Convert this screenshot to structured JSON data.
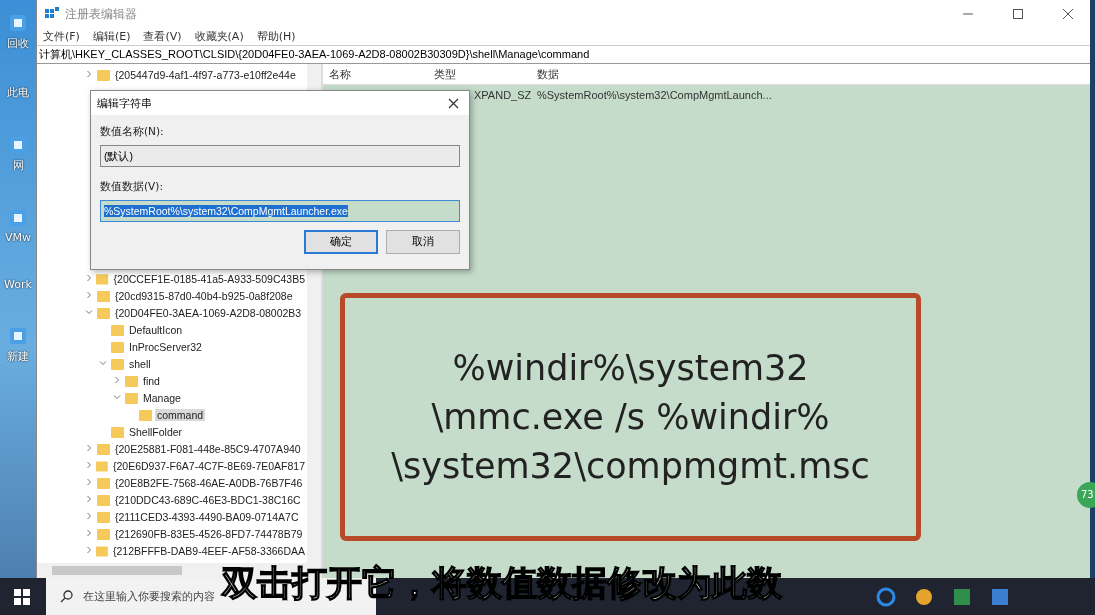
{
  "desktop_icons": [
    {
      "label": "回收"
    },
    {
      "label": "此电"
    },
    {
      "label": "网"
    },
    {
      "label": "VMw"
    },
    {
      "label": "Work"
    },
    {
      "label": "新建"
    }
  ],
  "window": {
    "title": "注册表编辑器",
    "menu": [
      "文件(F)",
      "编辑(E)",
      "查看(V)",
      "收藏夹(A)",
      "帮助(H)"
    ],
    "address": "计算机\\HKEY_CLASSES_ROOT\\CLSID\\{20D04FE0-3AEA-1069-A2D8-08002B30309D}\\shell\\Manage\\command"
  },
  "tree": [
    {
      "label": "{205447d9-4af1-4f97-a773-e10ff2e44e",
      "expandable": true,
      "expanded": false,
      "selected": false
    },
    {
      "label": "{20CCEF1E-0185-41a5-A933-509C43B5",
      "expandable": true,
      "expanded": false,
      "selected": false
    },
    {
      "label": "{20cd9315-87d0-40b4-b925-0a8f208e",
      "expandable": true,
      "expanded": false,
      "selected": false
    },
    {
      "label": "{20D04FE0-3AEA-1069-A2D8-08002B3",
      "expandable": true,
      "expanded": true,
      "selected": false,
      "children": [
        {
          "label": "DefaultIcon",
          "selected": false
        },
        {
          "label": "InProcServer32",
          "selected": false
        },
        {
          "label": "shell",
          "expandable": true,
          "expanded": true,
          "selected": false,
          "children": [
            {
              "label": "find",
              "expandable": true,
              "expanded": false,
              "selected": false
            },
            {
              "label": "Manage",
              "expandable": true,
              "expanded": true,
              "selected": false,
              "children": [
                {
                  "label": "command",
                  "selected": true
                }
              ]
            }
          ]
        },
        {
          "label": "ShellFolder",
          "selected": false
        }
      ]
    },
    {
      "label": "{20E25881-F081-448e-85C9-4707A940",
      "expandable": true,
      "expanded": false,
      "selected": false
    },
    {
      "label": "{20E6D937-F6A7-4C7F-8E69-7E0AF817",
      "expandable": true,
      "expanded": false,
      "selected": false
    },
    {
      "label": "{20E8B2FE-7568-46AE-A0DB-76B7F46",
      "expandable": true,
      "expanded": false,
      "selected": false
    },
    {
      "label": "{210DDC43-689C-46E3-BDC1-38C16C",
      "expandable": true,
      "expanded": false,
      "selected": false
    },
    {
      "label": "{2111CED3-4393-4490-BA09-0714A7C",
      "expandable": true,
      "expanded": false,
      "selected": false
    },
    {
      "label": "{212690FB-83E5-4526-8FD7-74478B79",
      "expandable": true,
      "expanded": false,
      "selected": false
    },
    {
      "label": "{212BFFFB-DAB9-4EEF-AF58-3366DAA",
      "expandable": true,
      "expanded": false,
      "selected": false
    }
  ],
  "values_table": {
    "columns": [
      "名称",
      "类型",
      "数据"
    ],
    "rows": [
      {
        "type": "XPAND_SZ",
        "data": "%SystemRoot%\\system32\\CompMgmtLaunch..."
      }
    ]
  },
  "dialog": {
    "title": "编辑字符串",
    "name_label": "数值名称(N):",
    "name_value": "(默认)",
    "data_label": "数值数据(V):",
    "data_value": "%SystemRoot%\\system32\\CompMgmtLauncher.exe",
    "data_selected": true,
    "buttons": [
      {
        "label": "确定",
        "focused": true
      },
      {
        "label": "取消",
        "focused": false
      }
    ]
  },
  "annotation": {
    "lines": [
      "%windir%\\system32",
      "\\mmc.exe /s %windir%",
      "\\system32\\compmgmt.msc"
    ]
  },
  "side_badge": "73",
  "subtitle": "双击打开它，将数值数据修改为此数",
  "taskbar": {
    "search_placeholder": "在这里输入你要搜索的内容"
  }
}
